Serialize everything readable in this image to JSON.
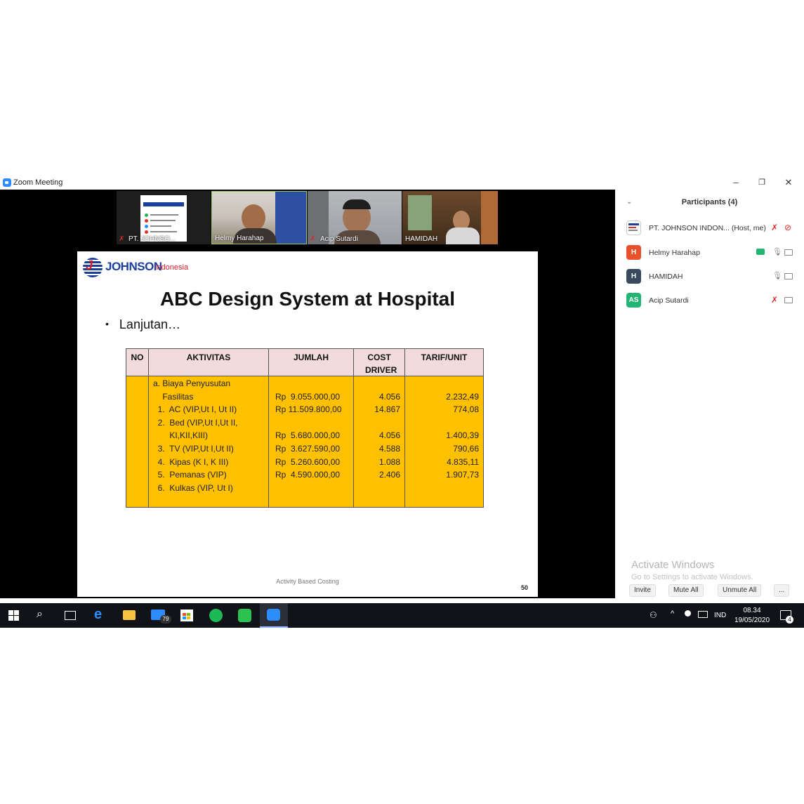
{
  "window": {
    "title": "Zoom Meeting",
    "minimize": "–",
    "restore": "❐",
    "close": "✕"
  },
  "thumbnails": [
    {
      "name": "PT. JOHNSO...",
      "muted": true
    },
    {
      "name": "Helmy Harahap",
      "muted": false
    },
    {
      "name": "Acip Sutardi",
      "muted": true
    },
    {
      "name": "HAMIDAH",
      "muted": false
    }
  ],
  "slide": {
    "logo_text": "JOHNSON",
    "logo_sub": "indonesia",
    "title": "ABC Design System at Hospital",
    "bullet": "Lanjutan…",
    "footer": "Activity Based Costing",
    "page_number": "50",
    "table": {
      "headers": [
        "NO",
        "AKTIVITAS",
        "JUMLAH",
        "COST DRIVER",
        "TARIF/UNIT"
      ],
      "aktivitas": "a. Biaya Penyusutan\n    Fasilitas\n  1.  AC (VIP,Ut I, Ut II)\n  2.  Bed (VIP,Ut I,Ut II,\n       KI,KII,KIII)\n  3.  TV (VIP,Ut I,Ut II)\n  4.  Kipas (K I, K III)\n  5.  Pemanas (VIP)\n  6.  Kulkas (VIP, Ut I)",
      "jumlah": "\nRp  9.055.000,00\nRp 11.509.800,00\n\nRp  5.680.000,00\nRp  3.627.590,00\nRp  5.260.600,00\nRp  4.590.000,00",
      "cost_driver": "\n4.056\n14.867\n\n4.056\n4.588\n1.088\n2.406",
      "tarif_unit": "\n2.232,49\n774,08\n\n1.400,39\n790,66\n4.835,11\n1.907,73"
    }
  },
  "participants": {
    "title": "Participants (4)",
    "list": [
      {
        "initials": "",
        "name": "PT. JOHNSON INDON... (Host, me)",
        "color": "#ffffff"
      },
      {
        "initials": "H",
        "name": "Helmy Harahap",
        "color": "#e8512c"
      },
      {
        "initials": "H",
        "name": "HAMIDAH",
        "color": "#3a4a5e"
      },
      {
        "initials": "AS",
        "name": "Acip Sutardi",
        "color": "#23b573"
      }
    ],
    "activate_title": "Activate Windows",
    "activate_sub": "Go to Settings to activate Windows.",
    "buttons": {
      "invite": "Invite",
      "mute_all": "Mute All",
      "unmute_all": "Unmute All",
      "more": "..."
    }
  },
  "taskbar": {
    "mail_badge": "79",
    "language": "IND",
    "time": "08.34",
    "date": "19/05/2020",
    "notifications": "4"
  }
}
